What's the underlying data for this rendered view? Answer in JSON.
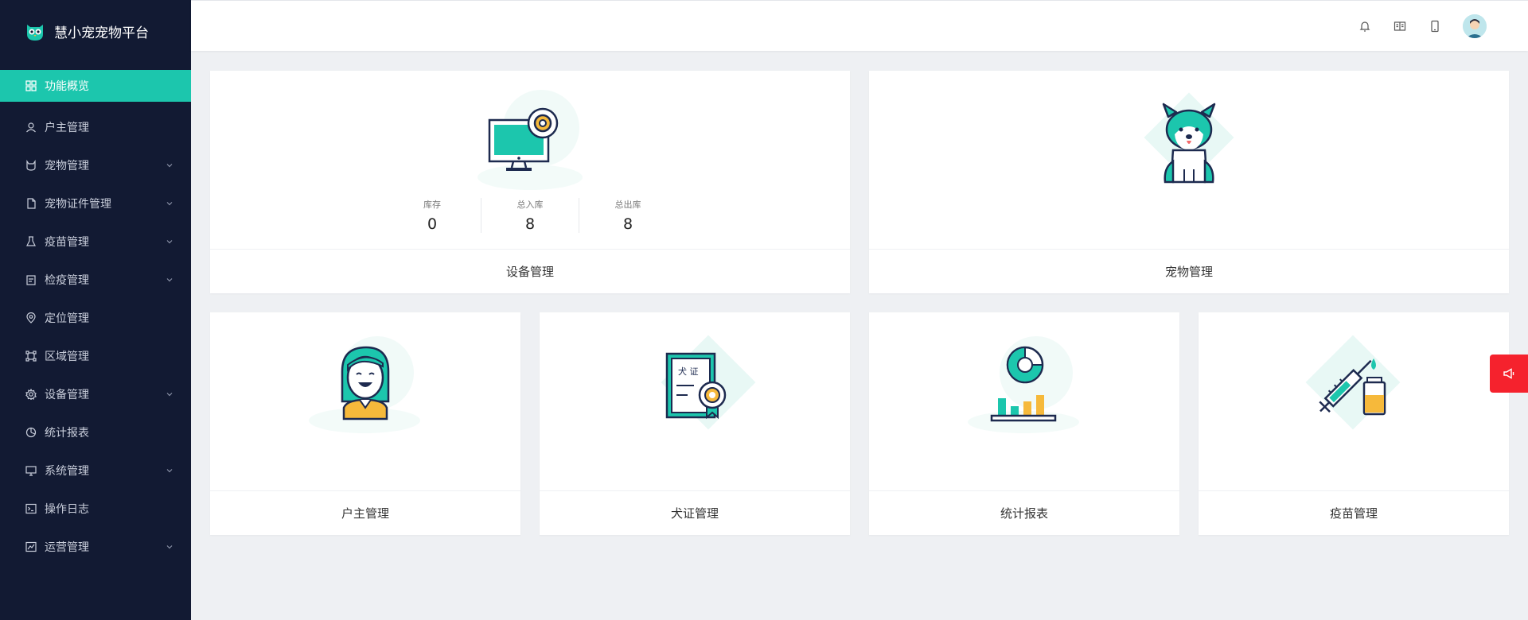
{
  "app": {
    "title": "慧小宠宠物平台"
  },
  "sidebar": {
    "items": [
      {
        "label": "功能概览",
        "icon": "grid-icon",
        "active": true
      },
      {
        "label": "户主管理",
        "icon": "user-icon"
      },
      {
        "label": "宠物管理",
        "icon": "cat-icon",
        "expandable": true
      },
      {
        "label": "宠物证件管理",
        "icon": "file-icon",
        "expandable": true
      },
      {
        "label": "疫苗管理",
        "icon": "flask-icon",
        "expandable": true
      },
      {
        "label": "检疫管理",
        "icon": "clipboard-icon",
        "expandable": true
      },
      {
        "label": "定位管理",
        "icon": "location-icon"
      },
      {
        "label": "区域管理",
        "icon": "area-icon"
      },
      {
        "label": "设备管理",
        "icon": "gear-icon",
        "expandable": true
      },
      {
        "label": "统计报表",
        "icon": "pie-icon"
      },
      {
        "label": "系统管理",
        "icon": "monitor-icon",
        "expandable": true
      },
      {
        "label": "操作日志",
        "icon": "terminal-icon"
      },
      {
        "label": "运营管理",
        "icon": "chart-line-icon",
        "expandable": true
      }
    ]
  },
  "header": {
    "icons": [
      "bell-icon",
      "book-icon",
      "phone-icon",
      "avatar"
    ]
  },
  "cards": {
    "device": {
      "title": "设备管理",
      "stats": [
        {
          "label": "库存",
          "value": "0"
        },
        {
          "label": "总入库",
          "value": "8"
        },
        {
          "label": "总出库",
          "value": "8"
        }
      ]
    },
    "pet": {
      "title": "宠物管理"
    },
    "owner": {
      "title": "户主管理"
    },
    "dog_license": {
      "title": "犬证管理",
      "badge_text": "犬 证"
    },
    "report": {
      "title": "统计报表"
    },
    "vaccine": {
      "title": "疫苗管理"
    }
  },
  "colors": {
    "accent": "#1cc6ad",
    "sidebar_bg": "#121a33",
    "alert": "#f5222d",
    "gold": "#f6b93b"
  }
}
